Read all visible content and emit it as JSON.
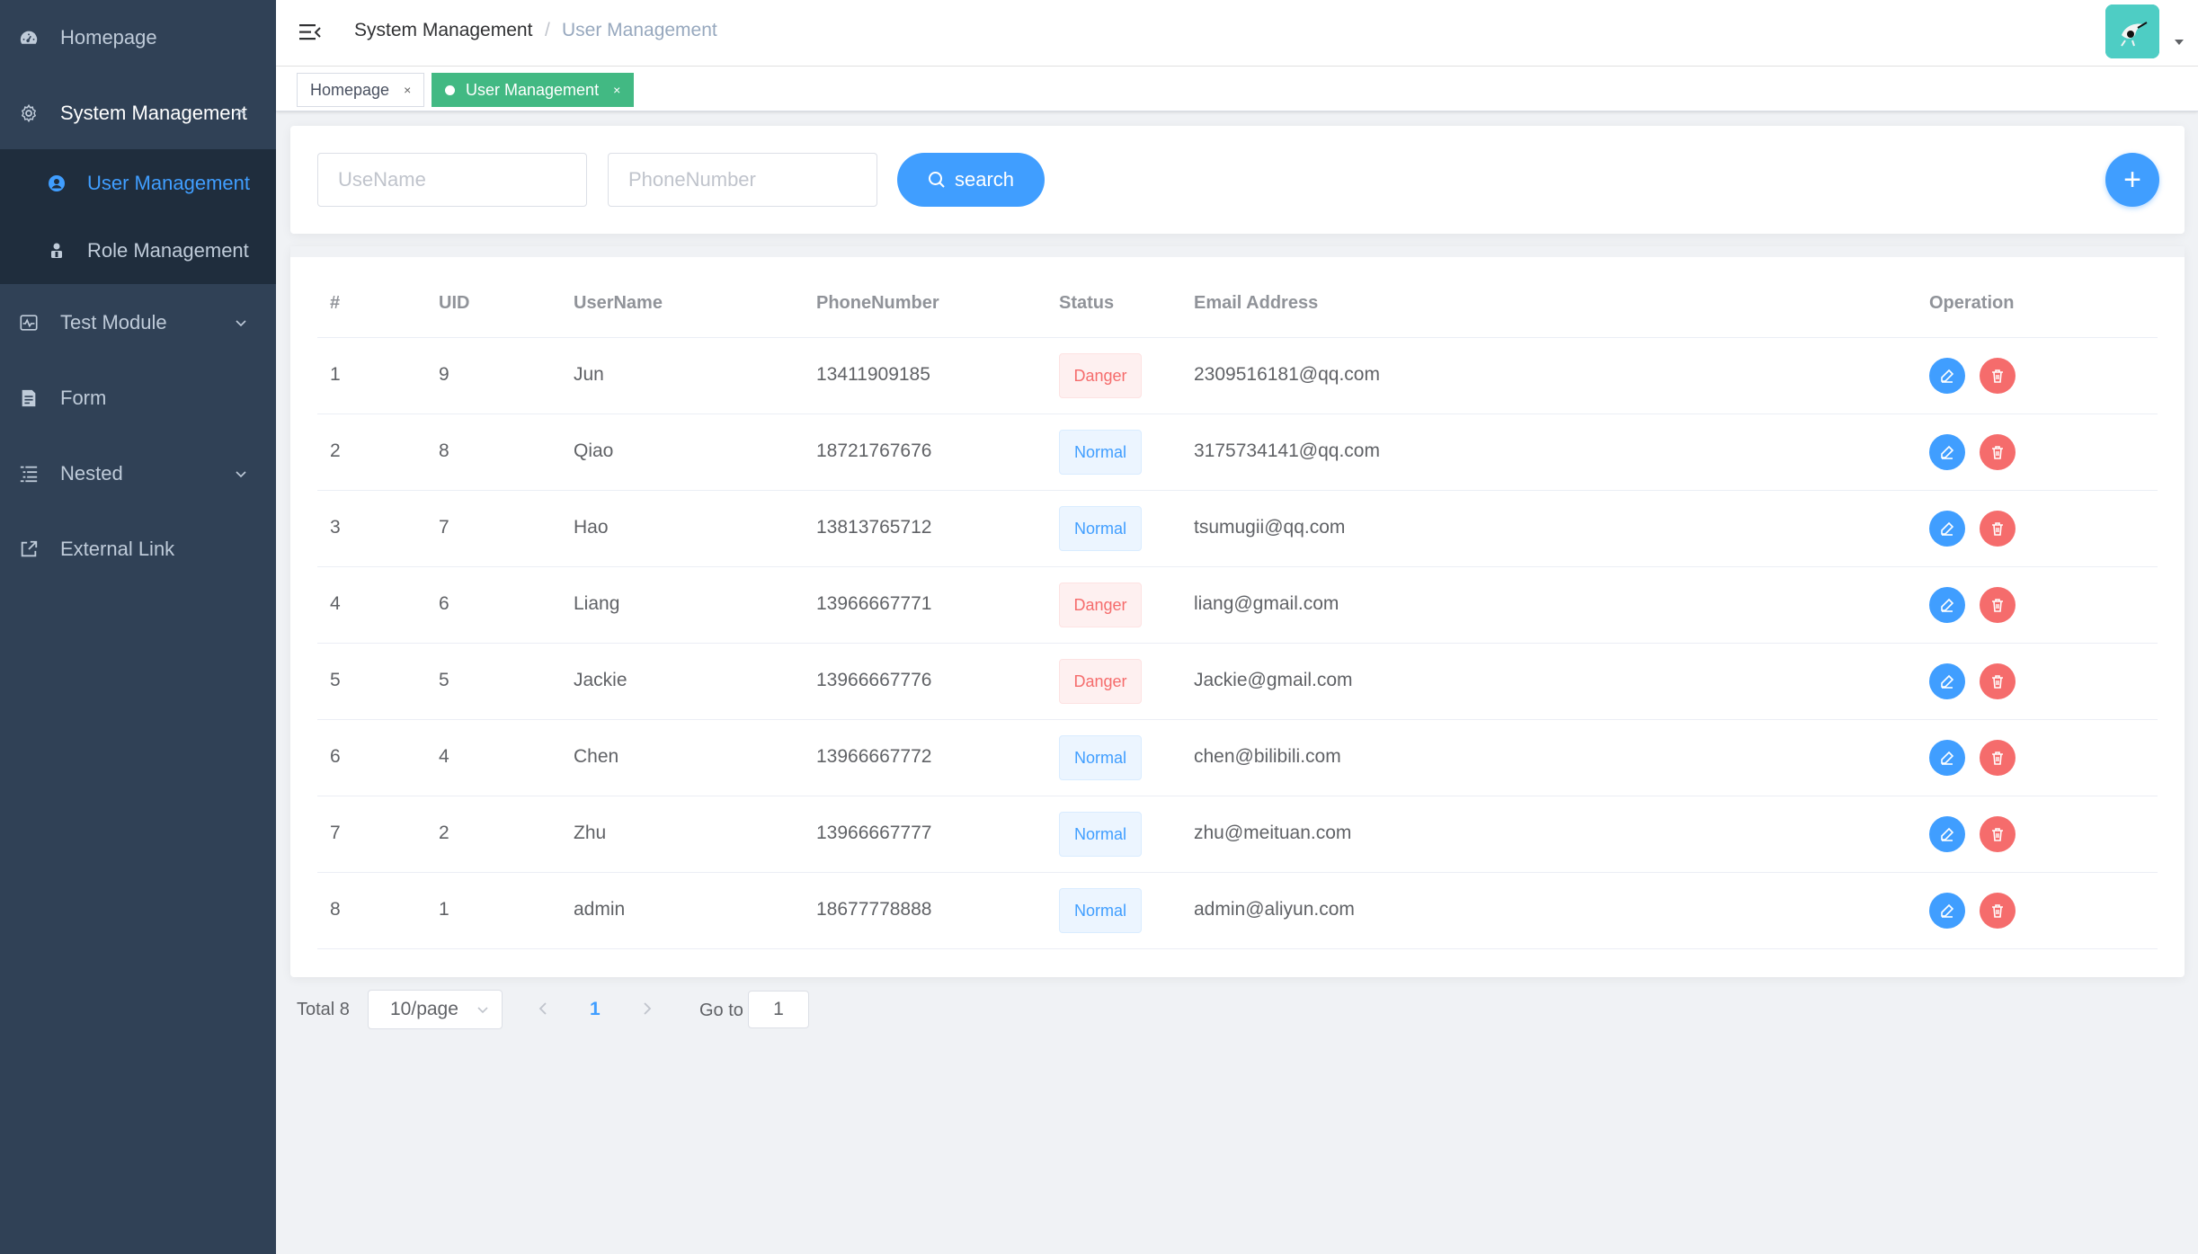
{
  "sidebar": {
    "items": [
      {
        "label": "Homepage",
        "icon": "dashboard-icon"
      },
      {
        "label": "System Management",
        "icon": "gear-icon"
      },
      {
        "label": "Test Module",
        "icon": "pulse-icon"
      },
      {
        "label": "Form",
        "icon": "form-icon"
      },
      {
        "label": "Nested",
        "icon": "tree-list-icon"
      },
      {
        "label": "External Link",
        "icon": "external-link-icon"
      }
    ],
    "submenu": [
      {
        "label": "User Management",
        "icon": "user-icon",
        "active": true
      },
      {
        "label": "Role Management",
        "icon": "role-icon",
        "active": false
      }
    ]
  },
  "header": {
    "breadcrumb": [
      "System Management",
      "User Management"
    ],
    "separator": "/"
  },
  "tags": [
    {
      "label": "Homepage",
      "close": "×"
    },
    {
      "label": "User Management",
      "close": "×"
    }
  ],
  "search": {
    "username_placeholder": "UseName",
    "phone_placeholder": "PhoneNumber",
    "button_label": "search",
    "add_label": "+"
  },
  "table": {
    "headers": [
      "#",
      "UID",
      "UserName",
      "PhoneNumber",
      "Status",
      "Email Address",
      "Operation"
    ],
    "rows": [
      {
        "index": "1",
        "uid": "9",
        "username": "Jun",
        "phone": "13411909185",
        "status": "Danger",
        "email": "2309516181@qq.com"
      },
      {
        "index": "2",
        "uid": "8",
        "username": "Qiao",
        "phone": "18721767676",
        "status": "Normal",
        "email": "3175734141@qq.com"
      },
      {
        "index": "3",
        "uid": "7",
        "username": "Hao",
        "phone": "13813765712",
        "status": "Normal",
        "email": "tsumugii@qq.com"
      },
      {
        "index": "4",
        "uid": "6",
        "username": "Liang",
        "phone": "13966667771",
        "status": "Danger",
        "email": "liang@gmail.com"
      },
      {
        "index": "5",
        "uid": "5",
        "username": "Jackie",
        "phone": "13966667776",
        "status": "Danger",
        "email": "Jackie@gmail.com"
      },
      {
        "index": "6",
        "uid": "4",
        "username": "Chen",
        "phone": "13966667772",
        "status": "Normal",
        "email": "chen@bilibili.com"
      },
      {
        "index": "7",
        "uid": "2",
        "username": "Zhu",
        "phone": "13966667777",
        "status": "Normal",
        "email": "zhu@meituan.com"
      },
      {
        "index": "8",
        "uid": "1",
        "username": "admin",
        "phone": "18677778888",
        "status": "Normal",
        "email": "admin@aliyun.com"
      }
    ]
  },
  "pagination": {
    "total": "Total 8",
    "page_size": "10/page",
    "current": "1",
    "goto_label": "Go to",
    "goto_value": "1"
  },
  "colors": {
    "sidebar_bg": "#304156",
    "submenu_bg": "#1f2d3d",
    "primary": "#409eff",
    "danger": "#f56c6c",
    "tag_active": "#42b983"
  }
}
